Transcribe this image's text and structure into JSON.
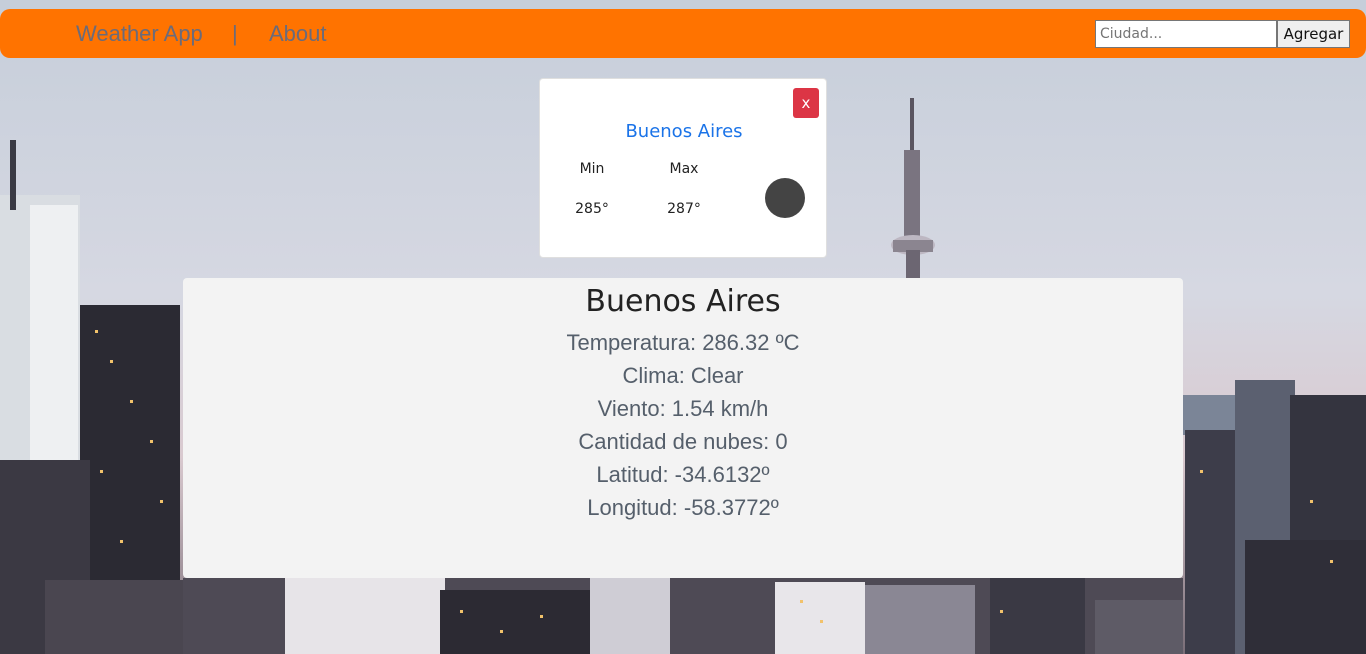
{
  "nav": {
    "brand": "Weather App",
    "separator": "|",
    "about": "About",
    "search_placeholder": "Ciudad...",
    "add_label": "Agregar",
    "bar_color": "#ff7300"
  },
  "card": {
    "close_label": "x",
    "city": "Buenos Aires",
    "min_label": "Min",
    "max_label": "Max",
    "min_value": "285°",
    "max_value": "287°",
    "icon": "weather-icon"
  },
  "detail": {
    "city": "Buenos Aires",
    "temperature": "Temperatura: 286.32 ºC",
    "weather": "Clima: Clear",
    "wind": "Viento: 1.54 km/h",
    "clouds": "Cantidad de nubes: 0",
    "latitude": "Latitud: -34.6132º",
    "longitude": "Longitud: -58.3772º"
  }
}
